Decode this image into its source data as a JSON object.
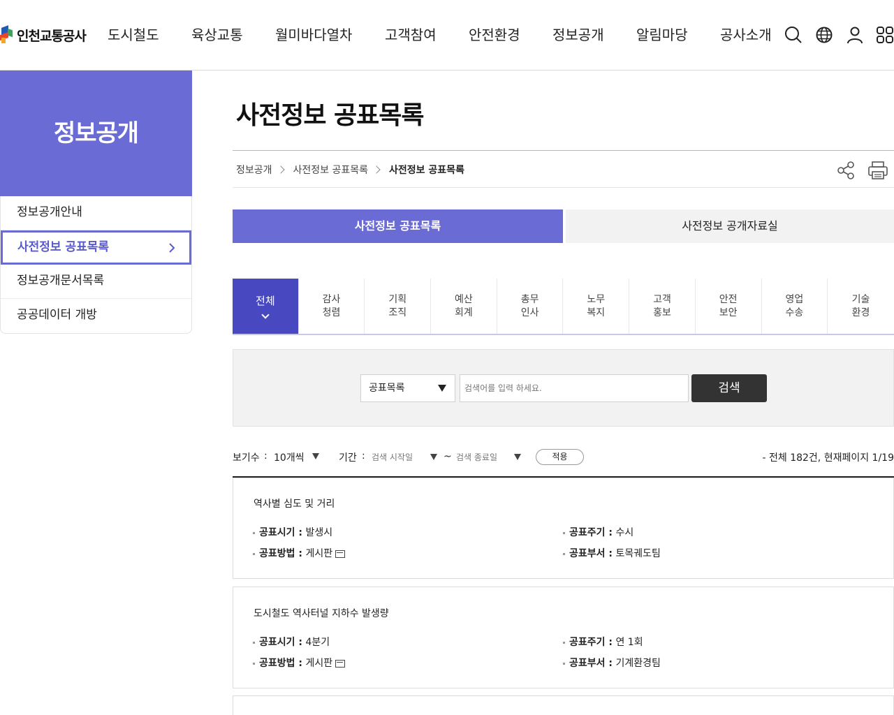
{
  "header": {
    "logo_text": "인천교통공사",
    "nav": [
      "도시철도",
      "육상교통",
      "월미바다열차",
      "고객참여",
      "안전환경",
      "정보공개",
      "알림마당",
      "공사소개"
    ],
    "utility_icons": [
      "search-icon",
      "globe-icon",
      "user-icon",
      "grid-menu-icon"
    ]
  },
  "sidebar": {
    "title": "정보공개",
    "items": [
      {
        "label": "정보공개안내"
      },
      {
        "label": "사전정보 공표목록"
      },
      {
        "label": "정보공개문서목록"
      },
      {
        "label": "공공데이터 개방"
      }
    ]
  },
  "page": {
    "title": "사전정보 공표목록",
    "breadcrumb": [
      "정보공개",
      "사전정보 공표목록",
      "사전정보 공표목록"
    ]
  },
  "tabs": [
    "사전정보 공표목록",
    "사전정보 공개자료실"
  ],
  "categories": [
    "전체",
    "감사\n청렴",
    "기획\n조직",
    "예산\n회계",
    "총무\n인사",
    "노무\n복지",
    "고객\n홍보",
    "안전\n보안",
    "영업\n수송",
    "기술\n환경"
  ],
  "search": {
    "select_value": "공표목록",
    "placeholder": "검색어를 입력 하세요.",
    "button": "검색"
  },
  "filter": {
    "view_label": "보기수",
    "view_colon": ":",
    "view_value": "10개씩",
    "period_label": "기간",
    "period_colon": ":",
    "start_placeholder": "검색 시작일",
    "tilde": "~",
    "end_placeholder": "검색 종료일",
    "apply": "적용",
    "total": "- 전체 182건, 현재페이지 1/19"
  },
  "records": [
    {
      "title": "역사별 심도 및 거리",
      "timing_label": "공표시기 :",
      "timing": "발생시",
      "cycle_label": "공표주기 :",
      "cycle": "수시",
      "method_label": "공표방법 :",
      "method": "게시판",
      "dept_label": "공표부서 :",
      "dept": "토목궤도팀"
    },
    {
      "title": "도시철도 역사터널 지하수 발생량",
      "timing_label": "공표시기 :",
      "timing": "4분기",
      "cycle_label": "공표주기 :",
      "cycle": "연 1회",
      "method_label": "공표방법 :",
      "method": "게시판",
      "dept_label": "공표부서 :",
      "dept": "기계환경팀"
    }
  ],
  "colors": {
    "accent": "#6b6bd6",
    "accent_dark": "#4848c0",
    "button_dark": "#333333"
  }
}
